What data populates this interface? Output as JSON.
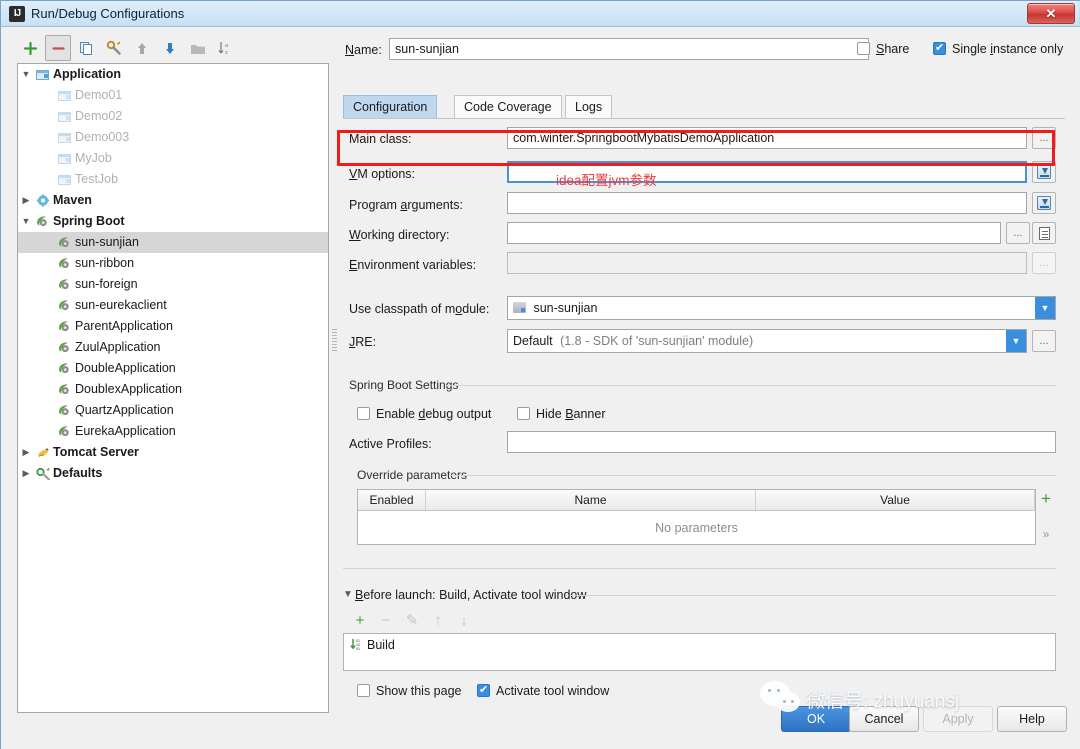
{
  "window": {
    "title": "Run/Debug Configurations",
    "app_icon": "intellij-idea-icon",
    "close_label": "✕"
  },
  "toolbar": {
    "items": [
      {
        "name": "add-configuration-button",
        "glyph": "+",
        "color": "#3c9a3c"
      },
      {
        "name": "remove-configuration-button",
        "glyph": "−",
        "color": "#cc4b43"
      },
      {
        "name": "copy-configuration-button",
        "glyph": "⧉",
        "color": "#5a87ad"
      },
      {
        "name": "edit-templates-button",
        "glyph": "⚙",
        "color": "#c98b2e"
      },
      {
        "name": "move-up-button",
        "glyph": "↑",
        "color": "#9a9a9a"
      },
      {
        "name": "move-down-button",
        "glyph": "↓",
        "color": "#2f7fc4"
      },
      {
        "name": "move-into-folder-button",
        "glyph": "▬",
        "color": "#a6a6a6"
      },
      {
        "name": "sort-configurations-button",
        "glyph": "↓AZ",
        "color": "#7a7a7a"
      }
    ]
  },
  "tree": {
    "items": [
      {
        "label": "Application",
        "level": 0,
        "twist": "▼",
        "group": true,
        "icon": "application-icon",
        "dim": false,
        "selected": false
      },
      {
        "label": "Demo01",
        "level": 1,
        "twist": "",
        "group": false,
        "icon": "application-icon",
        "dim": true,
        "selected": false
      },
      {
        "label": "Demo02",
        "level": 1,
        "twist": "",
        "group": false,
        "icon": "application-icon",
        "dim": true,
        "selected": false
      },
      {
        "label": "Demo003",
        "level": 1,
        "twist": "",
        "group": false,
        "icon": "application-icon",
        "dim": true,
        "selected": false
      },
      {
        "label": "MyJob",
        "level": 1,
        "twist": "",
        "group": false,
        "icon": "application-icon",
        "dim": true,
        "selected": false
      },
      {
        "label": "TestJob",
        "level": 1,
        "twist": "",
        "group": false,
        "icon": "application-icon",
        "dim": true,
        "selected": false
      },
      {
        "label": "Maven",
        "level": 0,
        "twist": "▶",
        "group": true,
        "icon": "maven-icon",
        "dim": false,
        "selected": false
      },
      {
        "label": "Spring Boot",
        "level": 0,
        "twist": "▼",
        "group": true,
        "icon": "spring-boot-icon",
        "dim": false,
        "selected": false
      },
      {
        "label": "sun-sunjian",
        "level": 1,
        "twist": "",
        "group": false,
        "icon": "spring-boot-icon",
        "dim": false,
        "selected": true
      },
      {
        "label": "sun-ribbon",
        "level": 1,
        "twist": "",
        "group": false,
        "icon": "spring-boot-icon",
        "dim": false,
        "selected": false
      },
      {
        "label": "sun-foreign",
        "level": 1,
        "twist": "",
        "group": false,
        "icon": "spring-boot-icon",
        "dim": false,
        "selected": false
      },
      {
        "label": "sun-eurekaclient",
        "level": 1,
        "twist": "",
        "group": false,
        "icon": "spring-boot-icon",
        "dim": false,
        "selected": false
      },
      {
        "label": "ParentApplication",
        "level": 1,
        "twist": "",
        "group": false,
        "icon": "spring-boot-icon",
        "dim": false,
        "selected": false
      },
      {
        "label": "ZuulApplication",
        "level": 1,
        "twist": "",
        "group": false,
        "icon": "spring-boot-icon",
        "dim": false,
        "selected": false
      },
      {
        "label": "DoubleApplication",
        "level": 1,
        "twist": "",
        "group": false,
        "icon": "spring-boot-icon",
        "dim": false,
        "selected": false
      },
      {
        "label": "DoublexApplication",
        "level": 1,
        "twist": "",
        "group": false,
        "icon": "spring-boot-icon",
        "dim": false,
        "selected": false
      },
      {
        "label": "QuartzApplication",
        "level": 1,
        "twist": "",
        "group": false,
        "icon": "spring-boot-icon",
        "dim": false,
        "selected": false
      },
      {
        "label": "EurekaApplication",
        "level": 1,
        "twist": "",
        "group": false,
        "icon": "spring-boot-icon",
        "dim": false,
        "selected": false
      },
      {
        "label": "Tomcat Server",
        "level": 0,
        "twist": "▶",
        "group": true,
        "icon": "tomcat-icon",
        "dim": false,
        "selected": false
      },
      {
        "label": "Defaults",
        "level": 0,
        "twist": "▶",
        "group": true,
        "icon": "defaults-icon",
        "dim": false,
        "selected": false
      }
    ]
  },
  "name_row": {
    "label": "Name:",
    "value": "sun-sunjian",
    "share_label": "Share",
    "share_checked": false,
    "single_instance_label": "Single instance only",
    "single_instance_checked": true
  },
  "tabs": [
    {
      "label": "Configuration",
      "active": true
    },
    {
      "label": "Code Coverage",
      "active": false
    },
    {
      "label": "Logs",
      "active": false
    }
  ],
  "form": {
    "main_class": {
      "label": "Main class:",
      "value": "com.winter.SpringbootMybatisDemoApplication",
      "browse": "..."
    },
    "vm_options": {
      "label": "VM options:",
      "value": "",
      "expand_icon": "expand-editor-icon"
    },
    "program_arguments": {
      "label": "Program arguments:",
      "value": "",
      "expand_icon": "expand-editor-icon"
    },
    "working_directory": {
      "label": "Working directory:",
      "value": "",
      "browse": "...",
      "macro_icon": "insert-macro-icon"
    },
    "environment_variables": {
      "label": "Environment variables:",
      "value": "",
      "browse": "..."
    },
    "classpath_module": {
      "label": "Use classpath of module:",
      "value": "sun-sunjian"
    },
    "jre": {
      "label": "JRE:",
      "value": "Default",
      "value_hint": "(1.8 - SDK of 'sun-sunjian' module)",
      "browse": "..."
    }
  },
  "spring_boot_settings": {
    "group_label": "Spring Boot Settings",
    "enable_debug_output_label": "Enable debug output",
    "enable_debug_output_checked": false,
    "hide_banner_label": "Hide Banner",
    "hide_banner_checked": false,
    "active_profiles_label": "Active Profiles:",
    "active_profiles_value": ""
  },
  "override_parameters": {
    "group_label": "Override parameters",
    "columns": [
      "Enabled",
      "Name",
      "Value"
    ],
    "empty_text": "No parameters",
    "add_button": "+",
    "more_button": "»"
  },
  "before_launch": {
    "title": "Before launch: Build, Activate tool window",
    "collapse_twist": "▼",
    "toolbar": [
      {
        "name": "add-task-button",
        "glyph": "+",
        "enabled": true
      },
      {
        "name": "remove-task-button",
        "glyph": "−",
        "enabled": false
      },
      {
        "name": "edit-task-button",
        "glyph": "✎",
        "enabled": false
      },
      {
        "name": "move-task-up-button",
        "glyph": "↑",
        "enabled": false
      },
      {
        "name": "move-task-down-button",
        "glyph": "↓",
        "enabled": false
      }
    ],
    "tasks": [
      {
        "label": "Build",
        "icon": "build-icon"
      }
    ],
    "show_this_page_label": "Show this page",
    "show_this_page_checked": false,
    "activate_tool_window_label": "Activate tool window",
    "activate_tool_window_checked": true
  },
  "dialog_buttons": [
    {
      "label": "OK",
      "primary": true,
      "enabled": true
    },
    {
      "label": "Cancel",
      "primary": false,
      "enabled": true
    },
    {
      "label": "Apply",
      "primary": false,
      "enabled": false
    },
    {
      "label": "Help",
      "primary": false,
      "enabled": true
    }
  ],
  "annotations": {
    "vm_options_highlight": "red-box-vm-options",
    "note_text": "idea配置jvm参数",
    "note_color": "#ef3b3b"
  },
  "watermark": {
    "text": "微信号: zhuyuansj",
    "logo": "wechat-logo"
  }
}
